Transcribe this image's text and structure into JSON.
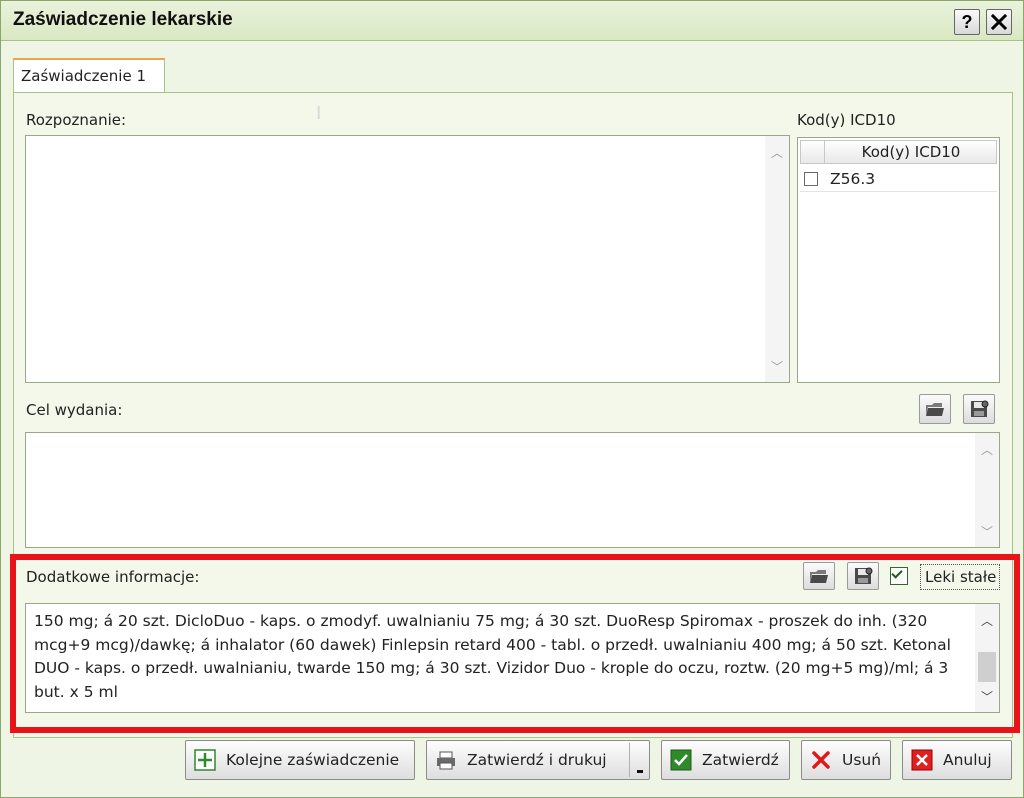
{
  "window": {
    "title": "Zaświadczenie lekarskie",
    "help_label": "?",
    "close_label": "✕"
  },
  "tabs": [
    {
      "label": "Zaświadczenie 1"
    }
  ],
  "rozpoznanie": {
    "label": "Rozpoznanie:",
    "value": ""
  },
  "icd": {
    "label": "Kod(y) ICD10",
    "column_header": "Kod(y) ICD10",
    "rows": [
      {
        "code": "Z56.3",
        "checked": false
      }
    ]
  },
  "cel": {
    "label": "Cel wydania:",
    "value": ""
  },
  "dodatkowe": {
    "label": "Dodatkowe informacje:",
    "value": "150 mg; á 20 szt.  DicloDuo - kaps. o zmodyf. uwalnianiu 75 mg; á 30 szt. DuoResp Spiromax - proszek do inh. (320 mcg+9 mcg)/dawkę; á inhalator (60 dawek) Finlepsin retard 400 - tabl. o przedł. uwalnianiu 400 mg; á 50 szt. Ketonal DUO - kaps. o przedł. uwalnianiu, twarde 150 mg; á 30 szt. Vizidor Duo - krople do oczu, roztw. (20 mg+5 mg)/ml; á 3 but. x 5 ml",
    "leki_stale_label": "Leki stałe",
    "leki_stale_checked": true
  },
  "buttons": {
    "kolejne": "Kolejne zaświadczenie",
    "zatwierdz_drukuj": "Zatwierdź i drukuj",
    "zatwierdz": "Zatwierdź",
    "usun": "Usuń",
    "anuluj": "Anuluj"
  },
  "icons": {
    "open": "folder-open-icon",
    "save": "save-icon",
    "add": "plus-icon",
    "print": "printer-icon",
    "confirm": "checkmark-icon",
    "delete": "red-x-icon",
    "cancel": "cancel-icon"
  },
  "colors": {
    "accent_green": "#2f8a2a",
    "highlight_red": "#e8141a",
    "tab_accent": "#f0a050",
    "panel_bg": "#f3f8ea"
  }
}
